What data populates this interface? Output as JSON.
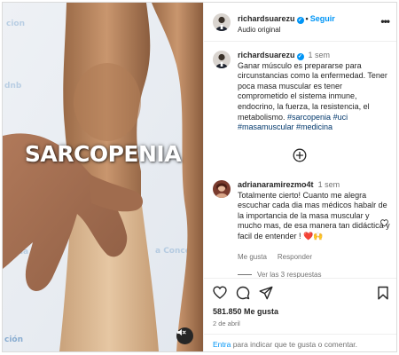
{
  "media": {
    "overlay_text": "SARCOPENIA",
    "audio_icon": "speaker-muted-icon"
  },
  "header": {
    "username": "richardsuarezu",
    "follow_label": "Seguir",
    "subtitle": "Audio original",
    "more_icon": "more-horizontal-icon"
  },
  "caption": {
    "username": "richardsuarezu",
    "time": "1 sem",
    "text_lines": [
      "Ganar músculo es prepararse para",
      "circunstancias como la enfermedad. Tener",
      "poca masa muscular es tener",
      "comprometido el sistema inmune,",
      "endocrino, la fuerza, la resistencia, el",
      "metabolismo. "
    ],
    "hashtags_line1": "#sarcopenia #uci",
    "hashtags_line2": "#masamuscular #medicina"
  },
  "load_more_icon": "plus-circle-icon",
  "comment": {
    "username": "adrianaramirezmo4t",
    "time": "1 sem",
    "text_lines": [
      "Totalmente cierto! Cuanto me alegra",
      "escuchar cada dia mas médicos habalr de",
      "la importancia de la masa muscular y",
      "mucho mas, de esa manera tan didáctica y",
      "facil de entender ! "
    ],
    "emojis": "❤️🙌",
    "likes_label": "Me gusta",
    "reply_label": "Responder",
    "view_replies": "Ver las 3 respuestas"
  },
  "actions": {
    "likes": "581.850 Me gusta",
    "date": "2 de abril",
    "icons": [
      "heart-icon",
      "comment-icon",
      "share-icon",
      "bookmark-icon"
    ]
  },
  "add_comment": {
    "login_link": "Entra",
    "rest": " para indicar que te gusta o comentar."
  },
  "colors": {
    "accent": "#0095f6",
    "hashtag": "#00376b",
    "muted": "#737373"
  }
}
